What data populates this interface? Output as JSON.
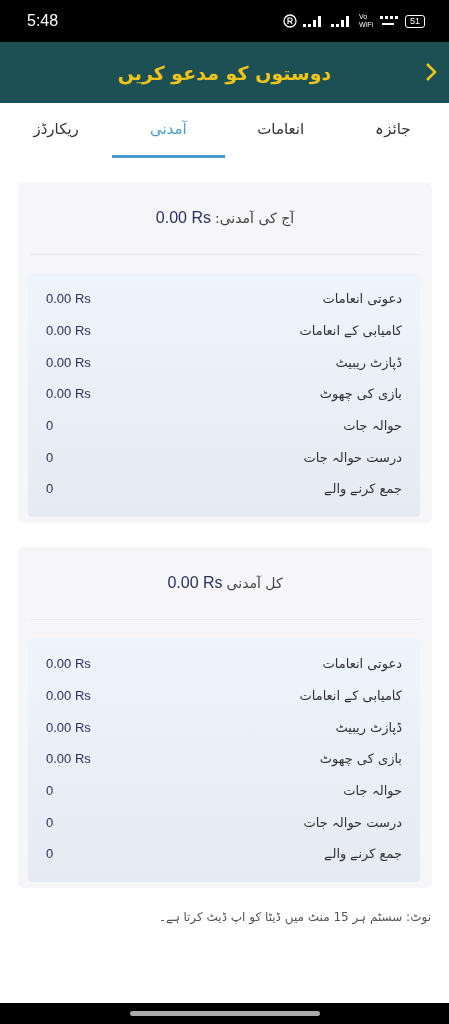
{
  "status_bar": {
    "time": "5:48",
    "wifi_calling": [
      "Vo",
      "WiFi"
    ],
    "battery": "51"
  },
  "header": {
    "title": "دوستوں کو مدعو کریں"
  },
  "tabs": [
    {
      "label": "جائزہ",
      "selected": false
    },
    {
      "label": "انعامات",
      "selected": false
    },
    {
      "label": "آمدنی",
      "selected": true
    },
    {
      "label": "ریکارڈز",
      "selected": false
    }
  ],
  "cards": [
    {
      "title_label": "آج کی آمدنی:",
      "title_amount": "0.00 Rs",
      "rows": [
        {
          "label": "دعوتی انعامات",
          "value": "0.00 Rs"
        },
        {
          "label": "کامیابی کے انعامات",
          "value": "0.00 Rs"
        },
        {
          "label": "ڈپازٹ ریبیٹ",
          "value": "0.00 Rs"
        },
        {
          "label": "بازی کی چھوٹ",
          "value": "0.00 Rs"
        },
        {
          "label": "حوالہ جات",
          "value": "0"
        },
        {
          "label": "درست حوالہ جات",
          "value": "0"
        },
        {
          "label": "جمع کرنے والے",
          "value": "0"
        }
      ]
    },
    {
      "title_label": "کل آمدنی",
      "title_amount": "0.00 Rs",
      "rows": [
        {
          "label": "دعوتی انعامات",
          "value": "0.00 Rs"
        },
        {
          "label": "کامیابی کے انعامات",
          "value": "0.00 Rs"
        },
        {
          "label": "ڈپازٹ ریبیٹ",
          "value": "0.00 Rs"
        },
        {
          "label": "بازی کی چھوٹ",
          "value": "0.00 Rs"
        },
        {
          "label": "حوالہ جات",
          "value": "0"
        },
        {
          "label": "درست حوالہ جات",
          "value": "0"
        },
        {
          "label": "جمع کرنے والے",
          "value": "0"
        }
      ]
    }
  ],
  "note": "نوٹ: سسٹم ہر 15 منٹ میں ڈیٹا کو اپ ڈیٹ کرتا ہے۔"
}
